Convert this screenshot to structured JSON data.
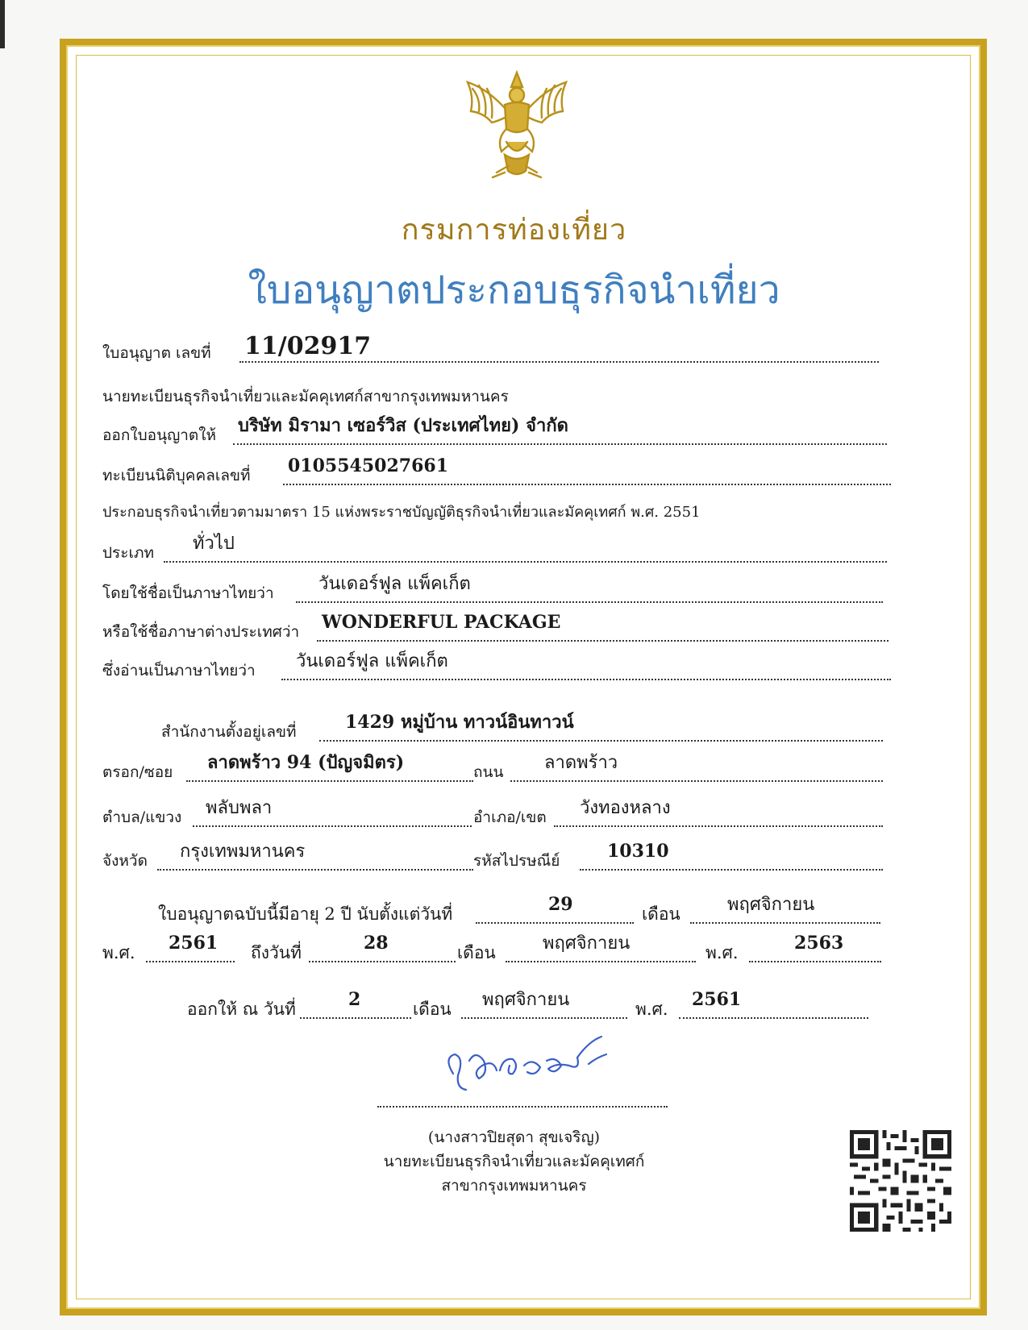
{
  "header": {
    "department": "กรมการท่องเที่ยว",
    "title": "ใบอนุญาตประกอบธุรกิจนำเที่ยว"
  },
  "license": {
    "number_label": "ใบอนุญาต เลขที่",
    "number": "11/02917",
    "registrar_line": "นายทะเบียนธุรกิจนำเที่ยวและมัคคุเทศก์สาขากรุงเทพมหานคร",
    "issued_to_label": "ออกใบอนุญาตให้",
    "issued_to": "บริษัท มิรามา เซอร์วิส (ประเทศไทย) จำกัด",
    "juristic_label": "ทะเบียนนิติบุคคลเลขที่",
    "juristic_no": "0105545027661",
    "act_line": "ประกอบธุรกิจนำเที่ยวตามมาตรา 15 แห่งพระราชบัญญัติธุรกิจนำเที่ยวและมัคคุเทศก์ พ.ศ. 2551",
    "type_label": "ประเภท",
    "type": "ทั่วไป",
    "thai_name_label": "โดยใช้ชื่อเป็นภาษาไทยว่า",
    "thai_name": "วันเดอร์ฟูล แพ็คเก็ต",
    "foreign_name_label": "หรือใช้ชื่อภาษาต่างประเทศว่า",
    "foreign_name": "WONDERFUL PACKAGE",
    "reading_label": "ซึ่งอ่านเป็นภาษาไทยว่า",
    "reading": "วันเดอร์ฟูล แพ็คเก็ต"
  },
  "address": {
    "office_label": "สำนักงานตั้งอยู่เลขที่",
    "office": "1429 หมู่บ้าน ทาวน์อินทาวน์",
    "soi_label": "ตรอก/ซอย",
    "soi": "ลาดพร้าว 94 (ปัญจมิตร)",
    "road_label": "ถนน",
    "road": "ลาดพร้าว",
    "subdistrict_label": "ตำบล/แขวง",
    "subdistrict": "พลับพลา",
    "district_label": "อำเภอ/เขต",
    "district": "วังทองหลาง",
    "province_label": "จังหวัด",
    "province": "กรุงเทพมหานคร",
    "postal_label": "รหัสไปรษณีย์",
    "postal": "10310"
  },
  "validity": {
    "intro": "ใบอนุญาตฉบับนี้มีอายุ 2 ปี นับตั้งแต่วันที่",
    "from_day": "29",
    "month_label": "เดือน",
    "from_month": "พฤศจิกายน",
    "be_label": "พ.ศ.",
    "from_year": "2561",
    "to_label": "ถึงวันที่",
    "to_day": "28",
    "to_month": "พฤศจิกายน",
    "to_year": "2563"
  },
  "issued": {
    "label": "ออกให้ ณ วันที่",
    "day": "2",
    "month_label": "เดือน",
    "month": "พฤศจิกายน",
    "be_label": "พ.ศ.",
    "year": "2561"
  },
  "signatory": {
    "name": "(นางสาวปิยสุดา สุขเจริญ)",
    "position": "นายทะเบียนธุรกิจนำเที่ยวและมัคคุเทศก์",
    "branch": "สาขากรุงเทพมหานคร"
  },
  "colors": {
    "gold": "#c8a21e",
    "title_blue": "#3f7fbf",
    "signature_blue": "#3b5fc8"
  }
}
